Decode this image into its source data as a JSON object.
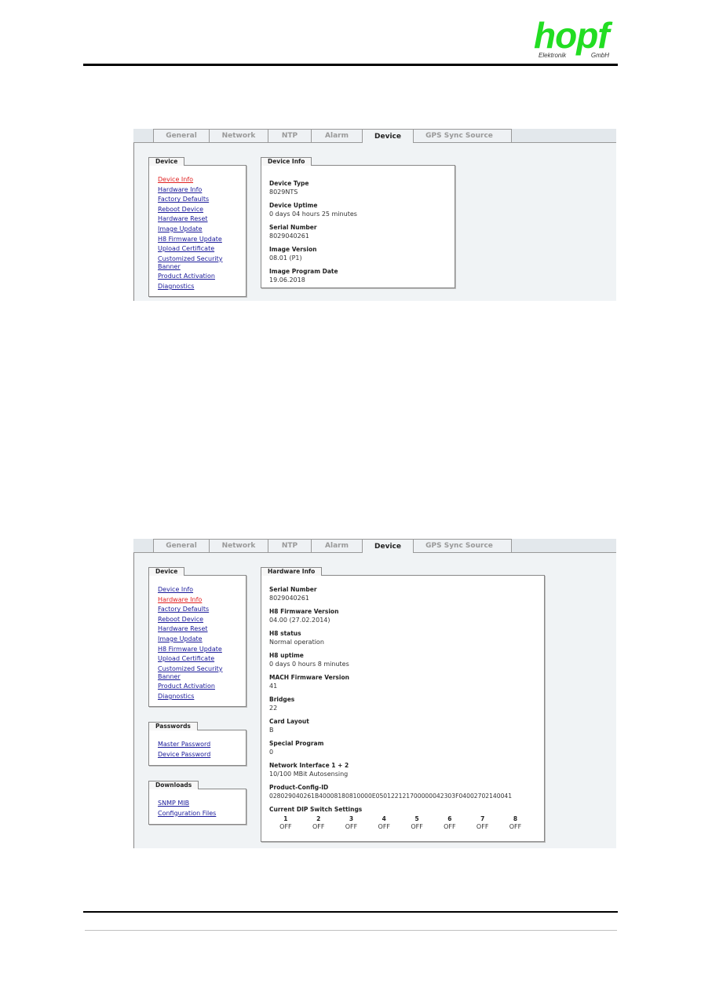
{
  "header": {
    "logo": {
      "word": "hopf",
      "left_text": "Elektronik",
      "right_text": "GmbH",
      "color": "#22dd22"
    }
  },
  "screenshot1": {
    "tabs": [
      {
        "label": "General",
        "active": false
      },
      {
        "label": "Network",
        "active": false
      },
      {
        "label": "NTP",
        "active": false
      },
      {
        "label": "Alarm",
        "active": false
      },
      {
        "label": "Device",
        "active": true
      },
      {
        "label": "GPS Sync Source",
        "active": false
      }
    ],
    "sidebar": {
      "title": "Device",
      "items": [
        {
          "label": "Device Info",
          "active": true
        },
        {
          "label": "Hardware Info"
        },
        {
          "label": "Factory Defaults"
        },
        {
          "label": "Reboot Device"
        },
        {
          "label": "Hardware Reset"
        },
        {
          "label": "Image Update"
        },
        {
          "label": "H8 Firmware Update"
        },
        {
          "label": "Upload Certificate"
        },
        {
          "label": "Customized Security Banner"
        },
        {
          "label": "Product Activation"
        },
        {
          "label": "Diagnostics"
        }
      ]
    },
    "panel": {
      "title": "Device Info",
      "fields": [
        {
          "label": "Device Type",
          "value": "8029NTS"
        },
        {
          "label": "Device Uptime",
          "value": "0 days 04 hours 25 minutes"
        },
        {
          "label": "Serial Number",
          "value": "8029040261"
        },
        {
          "label": "Image Version",
          "value": "08.01 (P1)"
        },
        {
          "label": "Image Program Date",
          "value": "19.06.2018"
        }
      ]
    }
  },
  "screenshot2": {
    "tabs": [
      {
        "label": "General",
        "active": false
      },
      {
        "label": "Network",
        "active": false
      },
      {
        "label": "NTP",
        "active": false
      },
      {
        "label": "Alarm",
        "active": false
      },
      {
        "label": "Device",
        "active": true
      },
      {
        "label": "GPS Sync Source",
        "active": false
      }
    ],
    "sidebar": {
      "title": "Device",
      "items": [
        {
          "label": "Device Info"
        },
        {
          "label": "Hardware Info",
          "active": true
        },
        {
          "label": "Factory Defaults"
        },
        {
          "label": "Reboot Device"
        },
        {
          "label": "Hardware Reset"
        },
        {
          "label": "Image Update"
        },
        {
          "label": "H8 Firmware Update"
        },
        {
          "label": "Upload Certificate"
        },
        {
          "label": "Customized Security Banner"
        },
        {
          "label": "Product Activation"
        },
        {
          "label": "Diagnostics"
        }
      ]
    },
    "passwords": {
      "title": "Passwords",
      "items": [
        {
          "label": "Master Password"
        },
        {
          "label": "Device Password"
        }
      ]
    },
    "downloads": {
      "title": "Downloads",
      "items": [
        {
          "label": "SNMP MIB"
        },
        {
          "label": "Configuration Files"
        }
      ]
    },
    "panel": {
      "title": "Hardware Info",
      "fields": [
        {
          "label": "Serial Number",
          "value": "8029040261"
        },
        {
          "label": "H8 Firmware Version",
          "value": "04.00 (27.02.2014)"
        },
        {
          "label": "H8 status",
          "value": "Normal operation"
        },
        {
          "label": "H8 uptime",
          "value": "0 days 0 hours 8 minutes"
        },
        {
          "label": "MACH Firmware Version",
          "value": "41"
        },
        {
          "label": "Bridges",
          "value": "22"
        },
        {
          "label": "Card Layout",
          "value": "B"
        },
        {
          "label": "Special Program",
          "value": "0"
        },
        {
          "label": "Network Interface 1 + 2",
          "value": "10/100 MBit Autosensing"
        },
        {
          "label": "Product-Config-ID",
          "value": "028029040261B40008180810000E05012212170000004230 3F04002702140041"
        }
      ],
      "dip_title": "Current DIP Switch Settings",
      "dip_switches": [
        {
          "num": "1",
          "state": "OFF"
        },
        {
          "num": "2",
          "state": "OFF"
        },
        {
          "num": "3",
          "state": "OFF"
        },
        {
          "num": "4",
          "state": "OFF"
        },
        {
          "num": "5",
          "state": "OFF"
        },
        {
          "num": "6",
          "state": "OFF"
        },
        {
          "num": "7",
          "state": "OFF"
        },
        {
          "num": "8",
          "state": "OFF"
        }
      ]
    }
  },
  "colors": {
    "link": "#1a1a9a",
    "active_link": "#e02020",
    "background": "#f0f3f5"
  }
}
